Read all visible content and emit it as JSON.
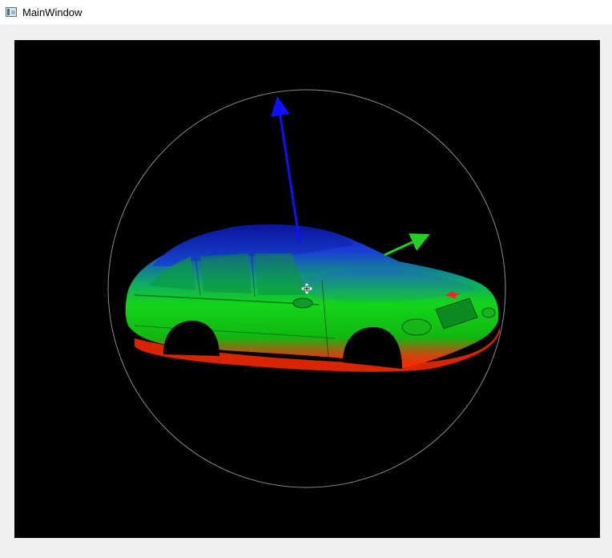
{
  "window": {
    "title": "MainWindow",
    "icon": "app-window-icon"
  },
  "viewport": {
    "description_icon": "3d-render-viewport",
    "background_color": "#000000",
    "trackball_color": "#8a8a8a",
    "axes": {
      "z_color": "#1010ff",
      "y_color": "#22d022",
      "x_color": "#ff2020"
    },
    "gradient": [
      "#1428c8",
      "#12c812",
      "#ff2a00"
    ],
    "cursor_icon": "move-crosshair-icon"
  }
}
